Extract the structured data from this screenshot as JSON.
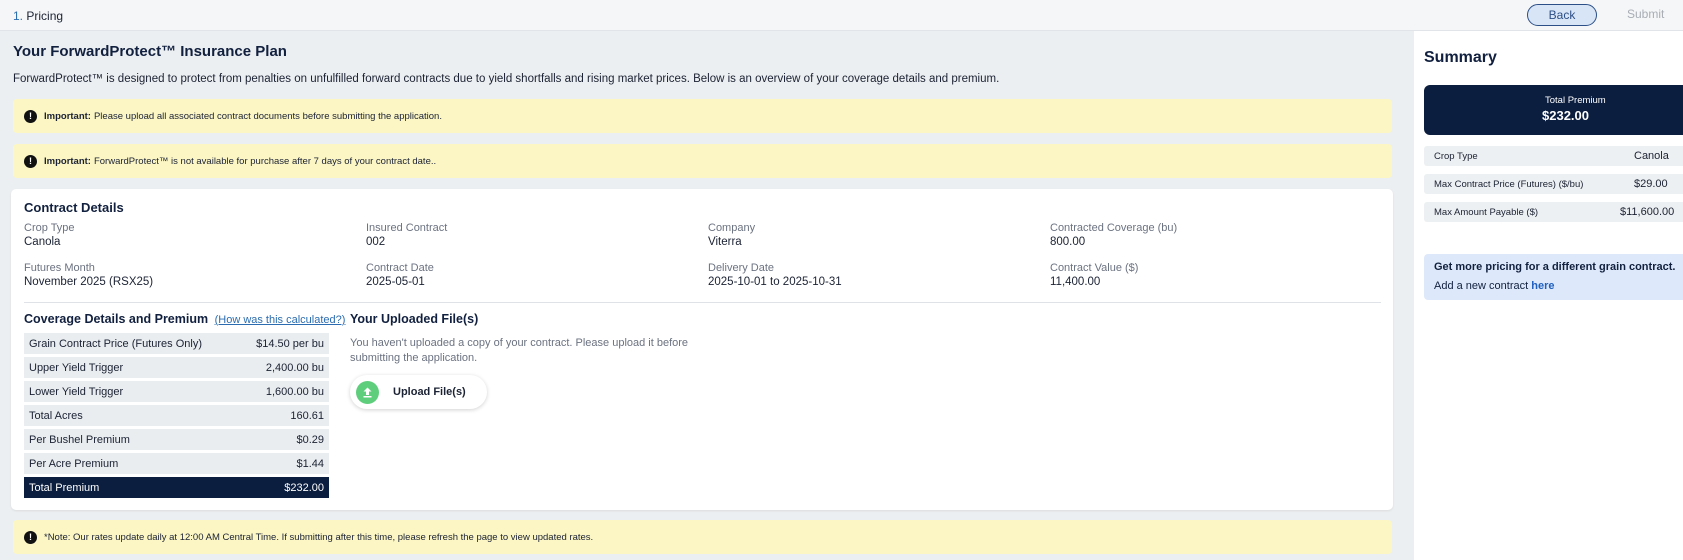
{
  "topbar": {
    "step_number": "1.",
    "step_label": "Pricing",
    "back_label": "Back",
    "submit_label": "Submit"
  },
  "page": {
    "title": "Your ForwardProtect™ Insurance Plan",
    "intro": "ForwardProtect™ is designed to protect from penalties on unfulfilled forward contracts due to yield shortfalls and rising market prices. Below is an overview of your coverage details and premium."
  },
  "alerts": {
    "upload": {
      "strong": "Important:",
      "text": "Please upload all associated contract documents before submitting the application."
    },
    "availability": {
      "strong": "Important:",
      "text": "ForwardProtect™ is not available for purchase after 7 days of your contract date.."
    },
    "note": {
      "text": "*Note: Our rates update daily at 12:00 AM Central Time. If submitting after this time, please refresh the page to view updated rates."
    }
  },
  "contract": {
    "title": "Contract Details",
    "fields": [
      {
        "label": "Crop Type",
        "value": "Canola"
      },
      {
        "label": "Insured Contract",
        "value": "002"
      },
      {
        "label": "Company",
        "value": "Viterra"
      },
      {
        "label": "Contracted Coverage (bu)",
        "value": "800.00"
      },
      {
        "label": "Futures Month",
        "value": "November 2025 (RSX25)"
      },
      {
        "label": "Contract Date",
        "value": "2025-05-01"
      },
      {
        "label": "Delivery Date",
        "value": "2025-10-01 to 2025-10-31"
      },
      {
        "label": "Contract Value ($)",
        "value": "11,400.00"
      }
    ]
  },
  "coverage": {
    "title": "Coverage Details and Premium",
    "link": "(How was this calculated?)",
    "rows": [
      {
        "label": "Grain Contract Price (Futures Only)",
        "value": "$14.50 per bu"
      },
      {
        "label": "Upper Yield Trigger",
        "value": "2,400.00 bu"
      },
      {
        "label": "Lower Yield Trigger",
        "value": "1,600.00 bu"
      },
      {
        "label": "Total Acres",
        "value": "160.61"
      },
      {
        "label": "Per Bushel Premium",
        "value": "$0.29"
      },
      {
        "label": "Per Acre Premium",
        "value": "$1.44"
      },
      {
        "label": "Total Premium",
        "value": "$232.00"
      }
    ]
  },
  "files": {
    "title": "Your Uploaded File(s)",
    "empty_text": "You haven't uploaded a copy of your contract. Please upload it before submitting the application.",
    "upload_label": "Upload File(s)"
  },
  "summary": {
    "title": "Summary",
    "premium_label": "Total Premium",
    "premium_value": "$232.00",
    "rows": [
      {
        "label": "Crop Type",
        "value": "Canola"
      },
      {
        "label": "Max Contract Price (Futures) ($/bu)",
        "value": "$29.00"
      },
      {
        "label": "Max Amount Payable ($)",
        "value": "$11,600.00"
      }
    ],
    "info_heading": "Get more pricing for a different grain contract.",
    "info_text": "Add a new contract",
    "info_link": "here"
  },
  "colors": {
    "navy": "#0b1e3f",
    "alert_yellow": "#fcf6c5",
    "info_blue": "#dde9fa",
    "upload_green": "#5fce7c"
  }
}
